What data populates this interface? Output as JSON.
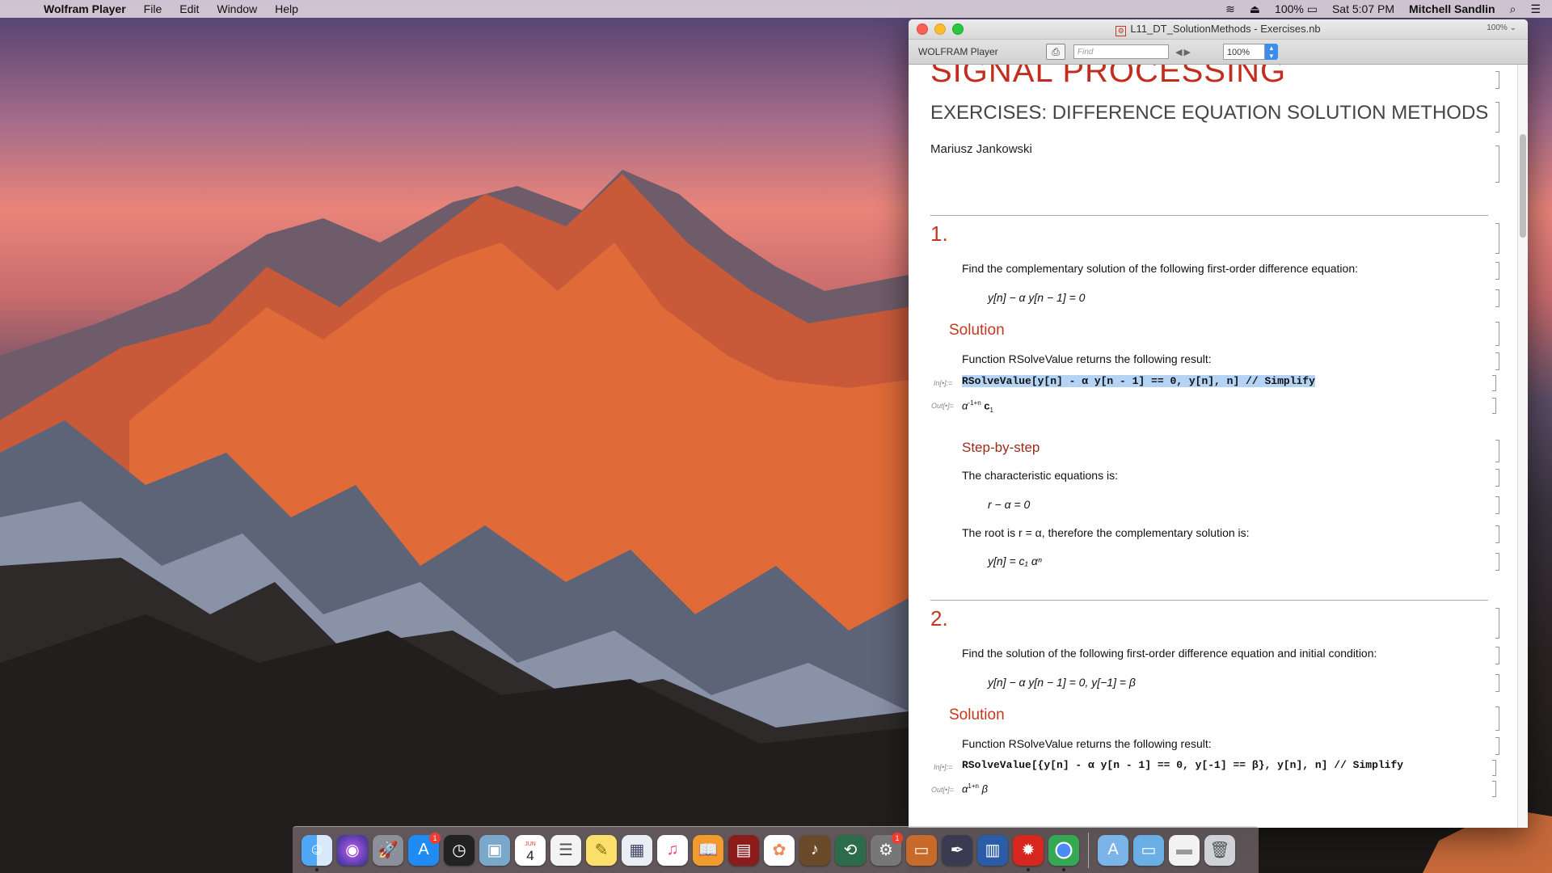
{
  "menubar": {
    "app_name": "Wolfram Player",
    "menus": [
      "File",
      "Edit",
      "Window",
      "Help"
    ],
    "battery": "100%",
    "datetime": "Sat 5:07 PM",
    "user": "Mitchell Sandlin"
  },
  "window": {
    "title": "L11_DT_SolutionMethods - Exercises.nb",
    "zoom_hint": "100%",
    "toolbar": {
      "brand": "WOLFRAM Player",
      "find_placeholder": "Find",
      "zoom_value": "100%"
    }
  },
  "notebook": {
    "heading": "SIGNAL PROCESSING",
    "subtitle": "EXERCISES: DIFFERENCE EQUATION SOLUTION METHODS",
    "author": "Mariusz Jankowski",
    "section1": {
      "number": "1.",
      "prompt": "Find the complementary solution of the following first-order difference equation:",
      "equation": "y[n] − α y[n − 1] = 0",
      "solution_heading": "Solution",
      "solution_text": "Function RSolveValue returns the following result:",
      "in_label": "In[•]:=",
      "input_code": "RSolveValue[y[n] - α y[n - 1] == 0, y[n], n] // Simplify",
      "out_label": "Out[•]=",
      "output_base": "α",
      "output_exp": "-1+n",
      "output_tail": "c",
      "output_sub": "1",
      "step_heading": "Step-by-step",
      "char_text": "The characteristic equations is:",
      "char_eq": "r − α = 0",
      "root_text": "The root is r = α, therefore the complementary solution is:",
      "final_eq": "y[n] = c₁ αⁿ"
    },
    "section2": {
      "number": "2.",
      "prompt": "Find the solution of the following first-order difference equation and initial condition:",
      "equation": "y[n] − α y[n − 1] = 0,   y[−1] = β",
      "solution_heading": "Solution",
      "solution_text": "Function RSolveValue returns the following result:",
      "in_label": "In[•]:=",
      "input_code": "RSolveValue[{y[n] - α y[n - 1] == 0, y[-1] == β}, y[n], n] // Simplify",
      "out_label": "Out[•]=",
      "output_base": "α",
      "output_exp": "1+n",
      "output_tail": "β"
    }
  },
  "dock": {
    "badges": {
      "app_store": "1",
      "system_prefs": "1"
    },
    "calendar_day": "4",
    "calendar_month": "JUN"
  }
}
